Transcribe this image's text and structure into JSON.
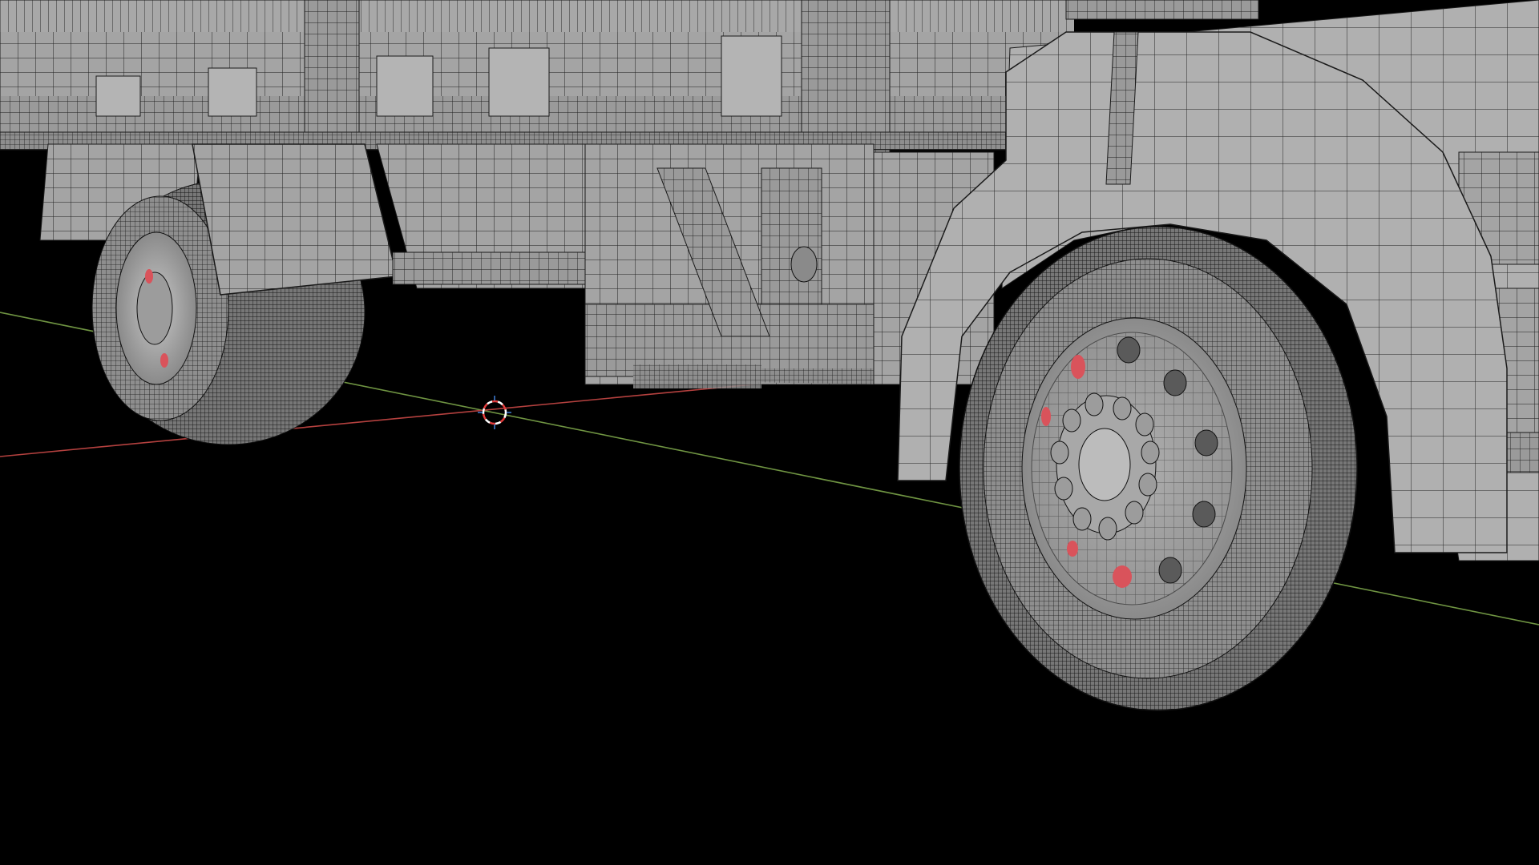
{
  "viewport": {
    "shading": "wireframe-overlay",
    "background_color": "#000000"
  },
  "colors": {
    "mesh_surface": "#a6a6a6",
    "mesh_surface_dark": "#8c8c8c",
    "mesh_surface_light": "#c2c2c2",
    "wire_color": "#1c1c1c",
    "selected_face": "#d9535b",
    "x_axis": "#b5413f",
    "y_axis": "#6f9442",
    "cursor_ring_red": "#e33b3b",
    "cursor_ring_white": "#ffffff",
    "cursor_ticks": "#3f7fd8"
  },
  "objects": [
    {
      "name": "truck-cargo-bed"
    },
    {
      "name": "front-fender"
    },
    {
      "name": "front-wheel"
    },
    {
      "name": "rear-wheel"
    },
    {
      "name": "side-step"
    },
    {
      "name": "fuel-tank"
    },
    {
      "name": "mud-flap"
    }
  ],
  "icons": {
    "cursor": "3d-cursor-icon"
  }
}
